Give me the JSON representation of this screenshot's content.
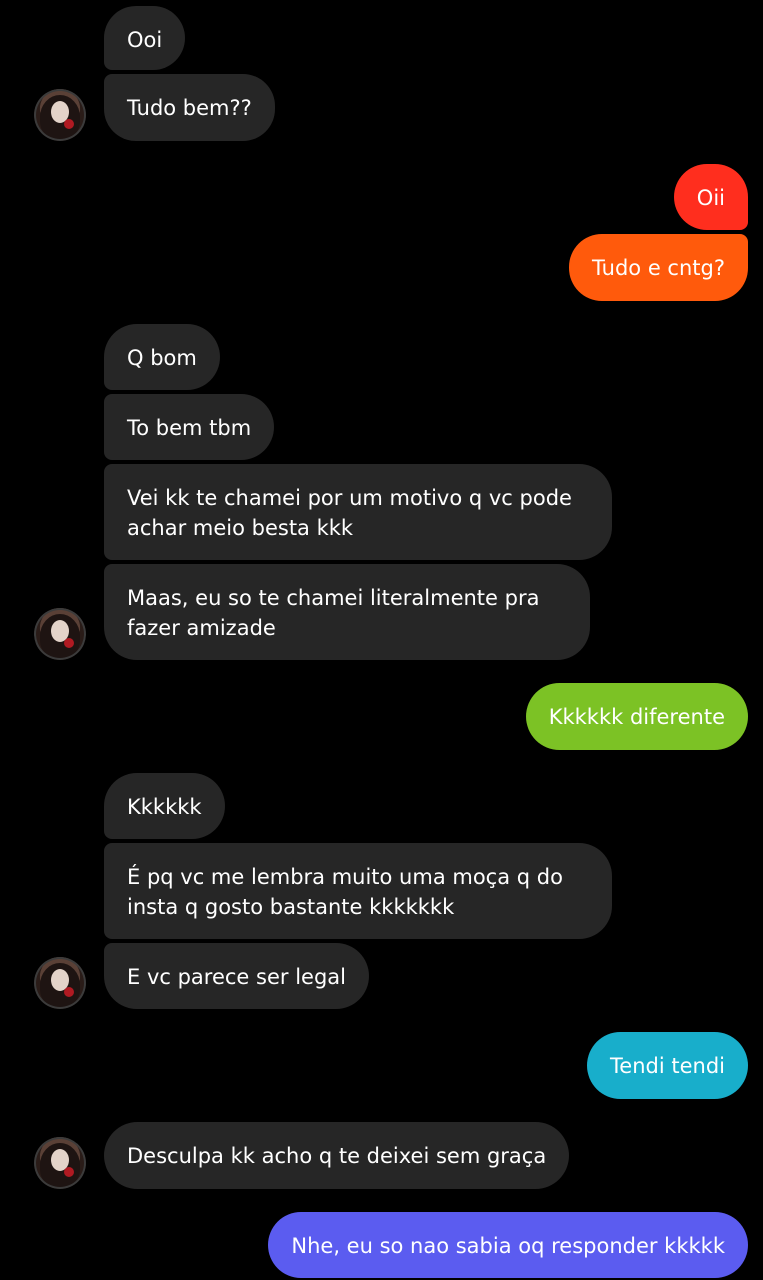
{
  "colors": {
    "background": "#000000",
    "received_bubble": "#262626",
    "sent_gradient_top": [
      "#ff3c1e",
      "#ff5a0a"
    ],
    "sent_gradient_mid": "#7cc223",
    "sent_gradient_teal": "#18aecb",
    "sent_gradient_bottom": "#5b5cf0"
  },
  "avatar_icon": "contact-avatar-photo",
  "messages": [
    {
      "side": "received",
      "text": "Ooi"
    },
    {
      "side": "received",
      "text": "Tudo bem??"
    },
    {
      "side": "sent",
      "text": "Oii"
    },
    {
      "side": "sent",
      "text": "Tudo e cntg?"
    },
    {
      "side": "received",
      "text": "Q bom"
    },
    {
      "side": "received",
      "text": "To bem tbm"
    },
    {
      "side": "received",
      "text": "Vei kk te chamei por um motivo q vc pode achar meio besta kkk"
    },
    {
      "side": "received",
      "text": "Maas, eu so te chamei literalmente pra fazer amizade"
    },
    {
      "side": "sent",
      "text": "Kkkkkk diferente"
    },
    {
      "side": "received",
      "text": "Kkkkkk"
    },
    {
      "side": "received",
      "text": "É pq vc me lembra muito uma moça q do insta q gosto bastante kkkkkkk"
    },
    {
      "side": "received",
      "text": "E vc parece ser legal"
    },
    {
      "side": "sent",
      "text": "Tendi tendi"
    },
    {
      "side": "received",
      "text": "Desculpa kk acho q te deixei sem graça"
    },
    {
      "side": "sent",
      "text": "Nhe, eu so nao sabia oq responder kkkkk"
    }
  ]
}
